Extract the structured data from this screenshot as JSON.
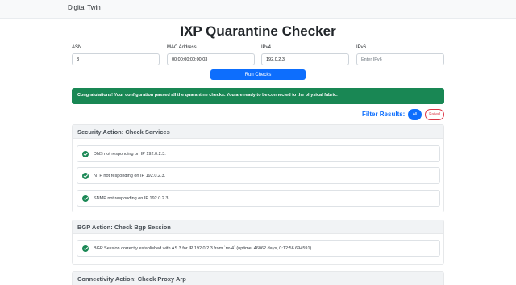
{
  "nav": {
    "brand": "Digital Twin"
  },
  "page": {
    "title": "IXP Quarantine Checker"
  },
  "form": {
    "asn": {
      "label": "ASN",
      "value": "3",
      "placeholder": ""
    },
    "mac": {
      "label": "MAC Address",
      "value": "00:00:00:00:00:03",
      "placeholder": ""
    },
    "ipv4": {
      "label": "IPv4",
      "value": "192.0.2.3",
      "placeholder": ""
    },
    "ipv6": {
      "label": "IPv6",
      "value": "",
      "placeholder": "Enter IPv6"
    },
    "run_label": "Run Checks"
  },
  "alert": {
    "message": "Congratulations! Your configuration passed all the quarantine checks. You are ready to be connected to the physical fabric."
  },
  "filter": {
    "label": "Filter Results:",
    "all_label": "All",
    "failed_label": "Failed",
    "active": "All"
  },
  "sections": [
    {
      "title": "Security Action: Check Services",
      "checks": [
        {
          "status": "passed",
          "text": "DNS not responding on IP 192.0.2.3."
        },
        {
          "status": "passed",
          "text": "NTP not responding on IP 192.0.2.3."
        },
        {
          "status": "passed",
          "text": "SNMP not responding on IP 192.0.2.3."
        }
      ]
    },
    {
      "title": "BGP Action: Check Bgp Session",
      "checks": [
        {
          "status": "passed",
          "text": "BGP Session correctly established with AS 3 for IP 192.0.2.3 from `rsv4` (uptime: 46062 days, 0:12:56.694591)."
        }
      ]
    },
    {
      "title": "Connectivity Action: Check Proxy Arp",
      "checks": []
    }
  ],
  "colors": {
    "primary": "#0d6efd",
    "success": "#198754",
    "danger": "#dc3545"
  }
}
